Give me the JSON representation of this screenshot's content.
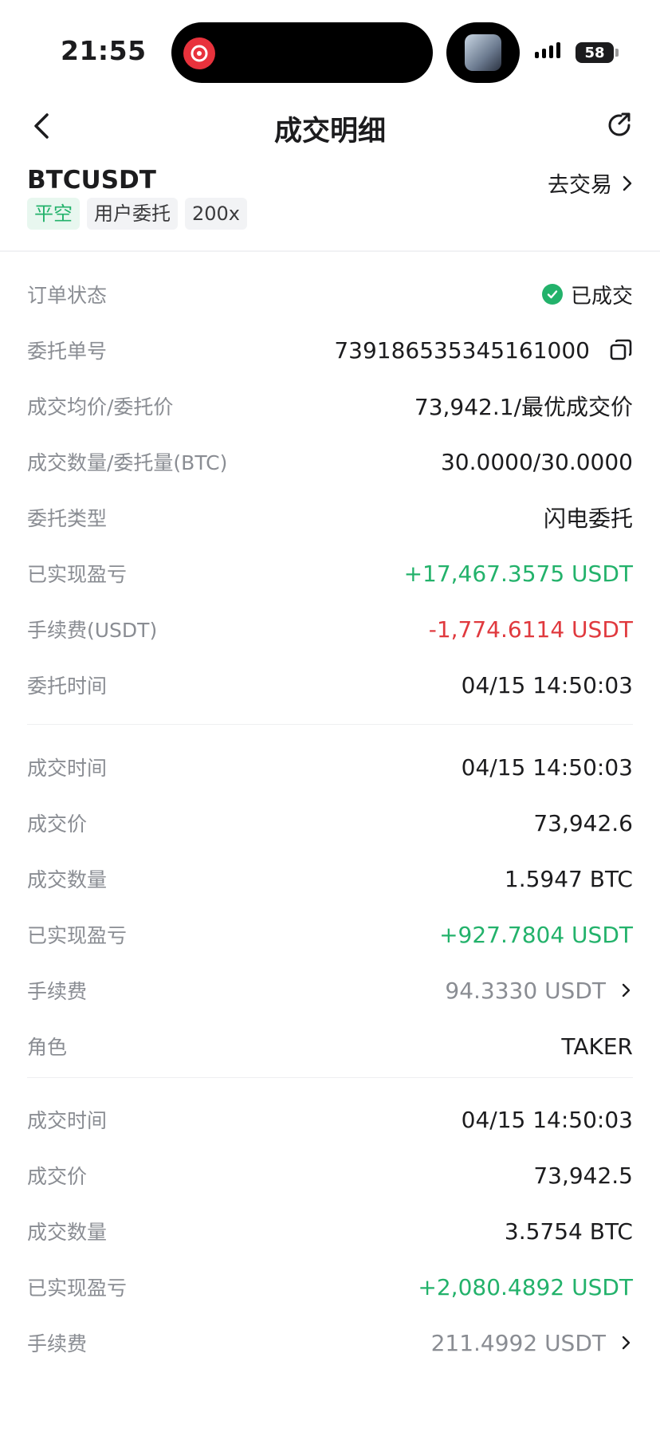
{
  "status_bar": {
    "time": "21:55",
    "battery": "58"
  },
  "nav": {
    "title": "成交明细"
  },
  "header": {
    "symbol": "BTCUSDT",
    "goto_trade": "去交易",
    "tags": [
      "平空",
      "用户委托",
      "200x"
    ]
  },
  "order": {
    "status_label": "订单状态",
    "status_value": "已成交",
    "order_id_label": "委托单号",
    "order_id_value": "739186535345161000",
    "avg_price_label": "成交均价/委托价",
    "avg_price_value": "73,942.1/最优成交价",
    "qty_label": "成交数量/委托量(BTC)",
    "qty_value": "30.0000/30.0000",
    "type_label": "委托类型",
    "type_value": "闪电委托",
    "pnl_label": "已实现盈亏",
    "pnl_value": "+17,467.3575 USDT",
    "fee_label": "手续费(USDT)",
    "fee_value": "-1,774.6114 USDT",
    "time_label": "委托时间",
    "time_value": "04/15 14:50:03"
  },
  "fills": [
    {
      "time_label": "成交时间",
      "time_value": "04/15 14:50:03",
      "price_label": "成交价",
      "price_value": "73,942.6",
      "qty_label": "成交数量",
      "qty_value": "1.5947 BTC",
      "pnl_label": "已实现盈亏",
      "pnl_value": "+927.7804 USDT",
      "fee_label": "手续费",
      "fee_value": "94.3330 USDT",
      "role_label": "角色",
      "role_value": "TAKER"
    },
    {
      "time_label": "成交时间",
      "time_value": "04/15 14:50:03",
      "price_label": "成交价",
      "price_value": "73,942.5",
      "qty_label": "成交数量",
      "qty_value": "3.5754 BTC",
      "pnl_label": "已实现盈亏",
      "pnl_value": "+2,080.4892 USDT",
      "fee_label": "手续费",
      "fee_value": "211.4992 USDT"
    }
  ],
  "colors": {
    "positive": "#23b26b",
    "negative": "#e0393e",
    "label": "#8a8d93"
  }
}
